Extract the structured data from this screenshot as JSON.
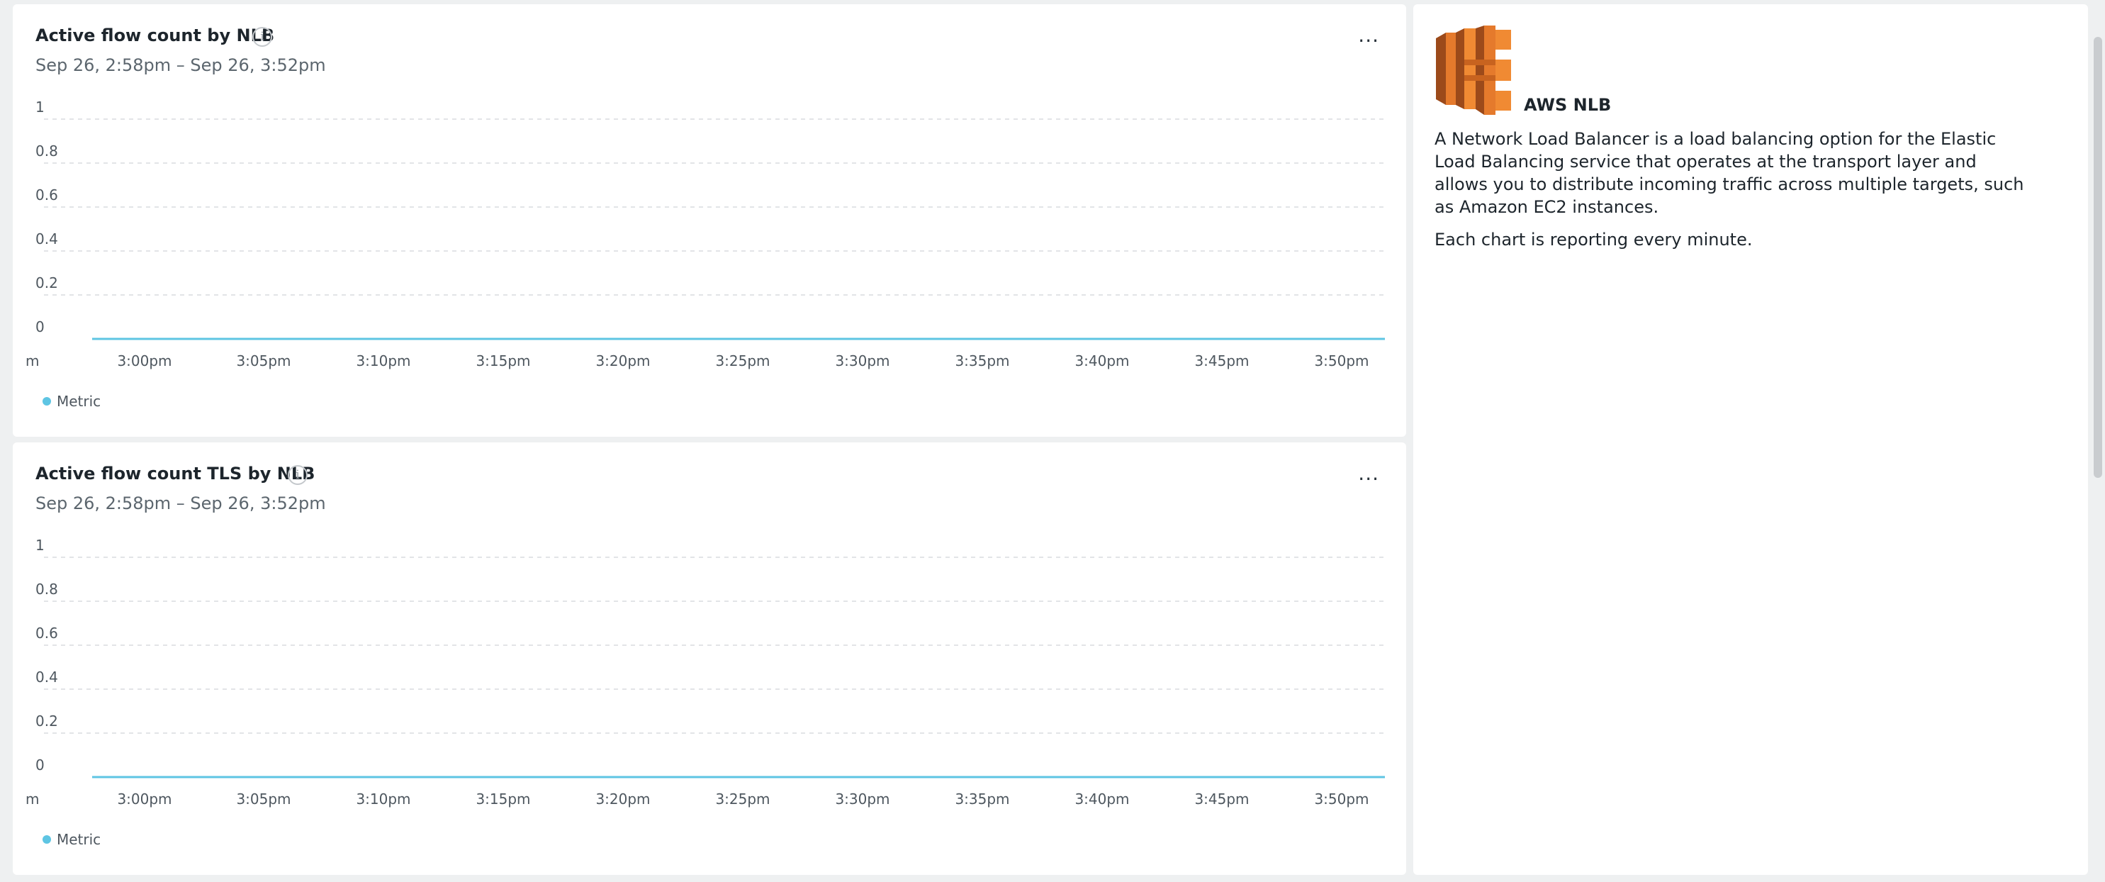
{
  "charts": [
    {
      "title": "Active flow count by NLB",
      "range": "Sep 26, 2:58pm – Sep 26, 3:52pm",
      "more_label": "...",
      "legend": "Metric",
      "chart_data": {
        "type": "line",
        "x": [
          "2:58pm",
          "3:52pm"
        ],
        "yticks": [
          "1",
          "0.8",
          "0.6",
          "0.4",
          "0.2",
          "0"
        ],
        "xticks": [
          "m",
          "3:00pm",
          "3:05pm",
          "3:10pm",
          "3:15pm",
          "3:20pm",
          "3:25pm",
          "3:30pm",
          "3:35pm",
          "3:40pm",
          "3:45pm",
          "3:50pm"
        ],
        "series": [
          {
            "name": "Metric",
            "color": "#5ec5e3",
            "values": [
              0,
              0
            ]
          }
        ],
        "ylim": [
          0,
          1
        ],
        "grid": true,
        "legend": "bottom-left"
      }
    },
    {
      "title": "Active flow count TLS by NLB",
      "range": "Sep 26, 2:58pm – Sep 26, 3:52pm",
      "more_label": "...",
      "legend": "Metric",
      "chart_data": {
        "type": "line",
        "x": [
          "2:58pm",
          "3:52pm"
        ],
        "yticks": [
          "1",
          "0.8",
          "0.6",
          "0.4",
          "0.2",
          "0"
        ],
        "xticks": [
          "m",
          "3:00pm",
          "3:05pm",
          "3:10pm",
          "3:15pm",
          "3:20pm",
          "3:25pm",
          "3:30pm",
          "3:35pm",
          "3:40pm",
          "3:45pm",
          "3:50pm"
        ],
        "series": [
          {
            "name": "Metric",
            "color": "#5ec5e3",
            "values": [
              0,
              0
            ]
          }
        ],
        "ylim": [
          0,
          1
        ],
        "grid": true,
        "legend": "bottom-left"
      }
    }
  ],
  "info_panel": {
    "logo_icon": "aws-nlb-icon",
    "service_name": "AWS NLB",
    "description": "A Network Load Balancer is a load balancing option for the Elastic Load Balancing service that operates at the transport layer and allows you to distribute incoming traffic across multiple targets, such as Amazon EC2 instances.",
    "note": "Each chart is reporting every minute."
  },
  "colors": {
    "series": "#5ec5e3",
    "logo_orange": "#e57a2c",
    "grid": "#d9dcdf"
  }
}
